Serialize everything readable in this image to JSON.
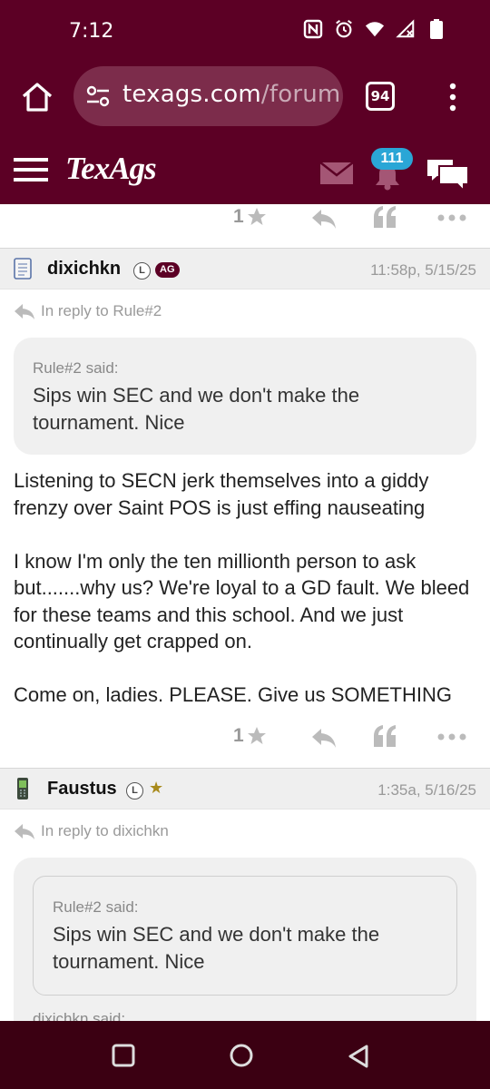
{
  "status_bar": {
    "time": "7:12"
  },
  "browser": {
    "url_main": "texags.com",
    "url_path": "/forum",
    "tab_count": "94"
  },
  "site": {
    "logo": "TexAgs",
    "notification_count": "111"
  },
  "top_actions": {
    "rating": "1"
  },
  "posts": [
    {
      "username": "dixichkn",
      "badge_l": "L",
      "badge_ag": "AG",
      "time": "11:58p, 5/15/25",
      "reply_to": "In reply to Rule#2",
      "quote": {
        "author": "Rule#2 said:",
        "text": "Sips win SEC and we don't make the tournament. Nice"
      },
      "paragraphs": [
        "Listening to SECN jerk themselves into a giddy frenzy over Saint POS is just effing nauseating",
        "I know I'm only the ten millionth person to ask but.......why us? We're loyal to a GD fault. We bleed for these teams and this school. And we just continually get crapped on.",
        "Come on, ladies. PLEASE. Give us SOMETHING"
      ],
      "rating": "1"
    },
    {
      "username": "Faustus",
      "badge_l": "L",
      "badge_star": "★",
      "time": "1:35a, 5/16/25",
      "reply_to": "In reply to dixichkn",
      "nested_quote": {
        "author": "Rule#2 said:",
        "text": "Sips win SEC and we don't make the tournament. Nice"
      },
      "next_quote_author": "dixichkn said:"
    }
  ],
  "colors": {
    "maroon": "#5c0025",
    "navbar": "#3b0012",
    "badge_blue": "#2aa6d6"
  }
}
